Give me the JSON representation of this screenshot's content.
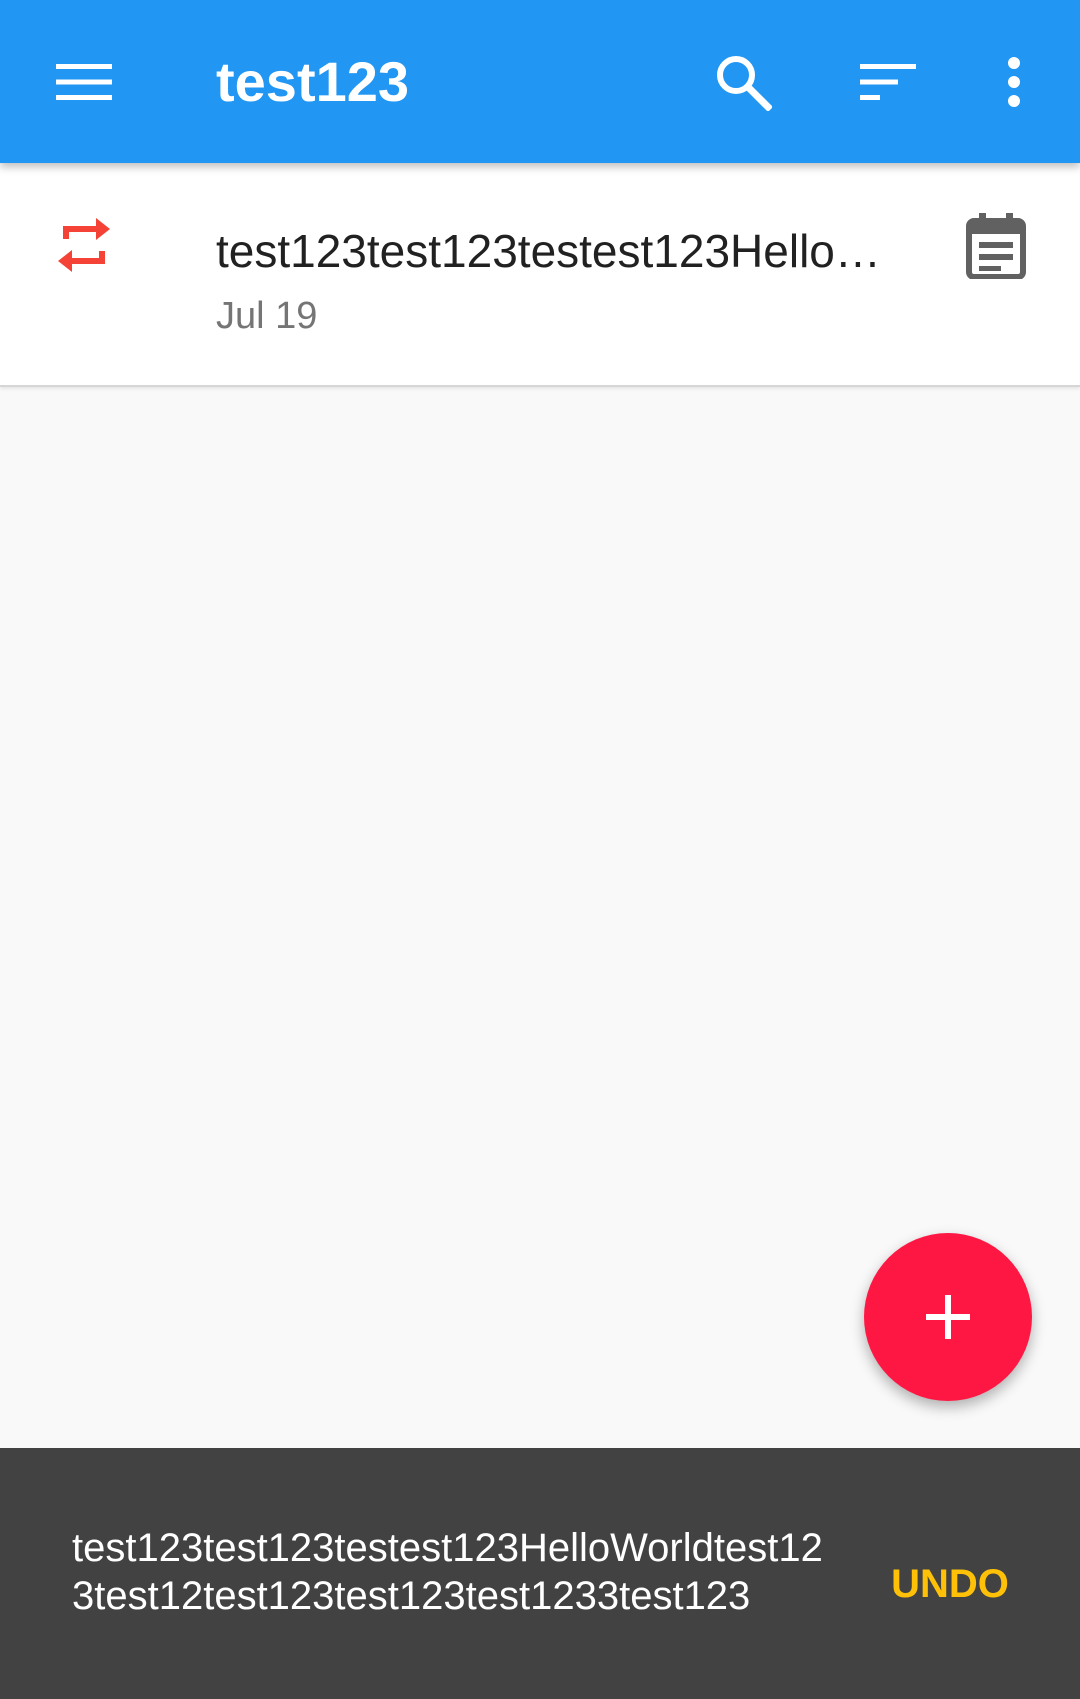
{
  "app_bar": {
    "title": "test123",
    "icons": {
      "menu": "hamburger-menu-icon",
      "search": "search-icon",
      "sort": "sort-icon",
      "more": "more-vert-icon"
    },
    "color": "#2196f3"
  },
  "tasks": [
    {
      "title": "test123test123testest123HelloWorldtest123test12test123test123test1233test123",
      "date": "Jul 19",
      "left_icon": "repeat-icon",
      "right_icon": "calendar-note-icon"
    }
  ],
  "fab": {
    "icon": "plus-icon",
    "color": "#ff1744"
  },
  "snackbar": {
    "message": "test123test123testest123HelloWorldtest123test12test123test123test1233test123",
    "action_label": "UNDO",
    "action_color": "#ffc107"
  }
}
